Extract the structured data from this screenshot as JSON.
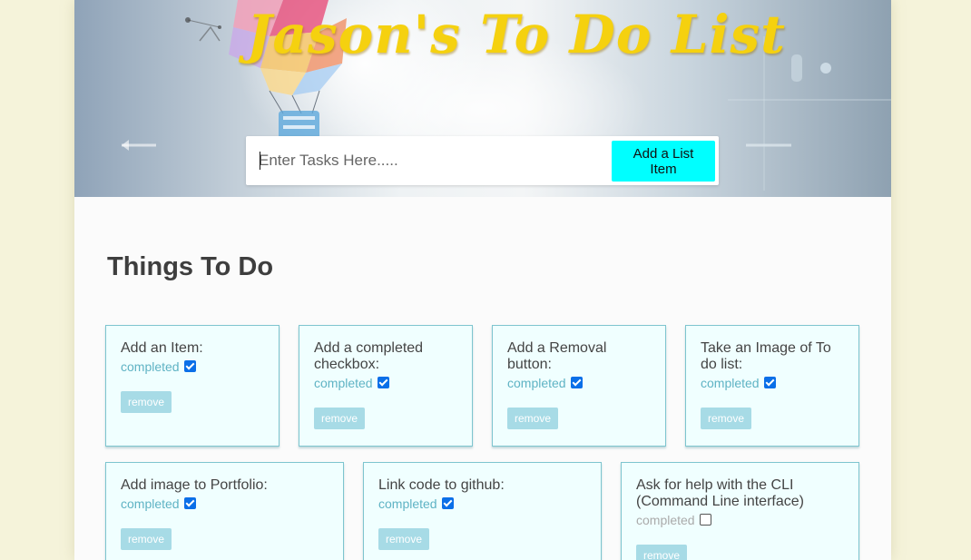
{
  "header": {
    "title": "Jason's To Do List",
    "input_placeholder": "Enter Tasks Here.....",
    "add_button_label": "Add a List Item"
  },
  "section_title": "Things To Do",
  "completed_label": "completed",
  "remove_label": "remove",
  "tasks": [
    {
      "title": "Add an Item:",
      "completed": true
    },
    {
      "title": "Add a completed checkbox:",
      "completed": true
    },
    {
      "title": "Add a Removal button:",
      "completed": true
    },
    {
      "title": "Take an Image of To do list:",
      "completed": true
    },
    {
      "title": "Add image to Portfolio:",
      "completed": true
    },
    {
      "title": "Link code to github:",
      "completed": true
    },
    {
      "title": "Ask for help with the CLI (Command Line interface)",
      "completed": false
    }
  ],
  "colors": {
    "title_yellow": "#f5d10f",
    "add_button": "#00ffff",
    "card_bg": "#f0ffff",
    "card_border": "#7ec5cf",
    "remove_button": "#a7dbe6",
    "completed_text": "#5fb3c4",
    "checkbox_checked": "#0b6fe8"
  }
}
